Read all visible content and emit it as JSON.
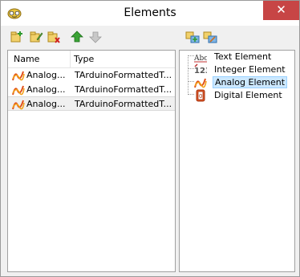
{
  "window": {
    "title": "Elements",
    "close_glyph": "✕"
  },
  "toolbar": {
    "left_buttons": [
      "add-element-icon",
      "edit-element-icon",
      "delete-element-icon",
      "move-up-icon",
      "move-down-icon"
    ],
    "right_buttons": [
      "add-to-list-icon",
      "edit-list-icon"
    ]
  },
  "list": {
    "columns": [
      "Name",
      "Type"
    ],
    "rows": [
      {
        "name": "Analog...",
        "type": "TArduinoFormattedT...",
        "selected": false
      },
      {
        "name": "Analog...",
        "type": "TArduinoFormattedT...",
        "selected": false
      },
      {
        "name": "Analog...",
        "type": "TArduinoFormattedT...",
        "selected": true
      }
    ]
  },
  "tree": {
    "items": [
      {
        "label": "Text Element",
        "icon": "text-element-icon"
      },
      {
        "label": "Integer Element",
        "icon": "integer-element-icon"
      },
      {
        "label": "Analog Element",
        "icon": "analog-element-icon",
        "selected": true
      },
      {
        "label": "Digital Element",
        "icon": "digital-element-icon"
      }
    ]
  },
  "colors": {
    "close": "#c74545",
    "selection": "#cce8ff",
    "accent_green": "#3aa335"
  }
}
